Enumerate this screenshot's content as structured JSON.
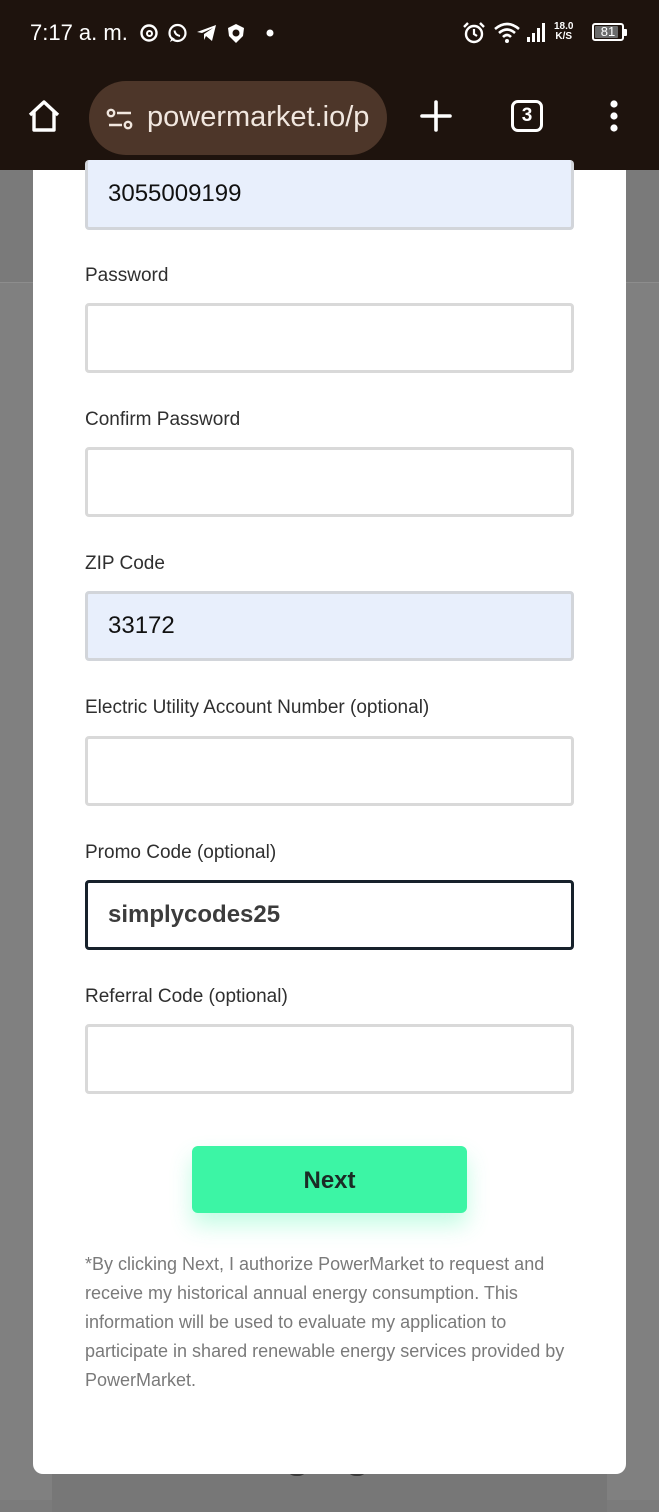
{
  "status_bar": {
    "time": "7:17 a. m.",
    "net_speed_value": "18.0",
    "net_speed_unit": "K/S",
    "battery": "81",
    "icons": [
      "threads-icon",
      "whatsapp-icon",
      "telegram-icon",
      "vpn-shield-icon",
      "notification-dot-icon",
      "alarm-icon",
      "wifi-icon",
      "signal-icon",
      "battery-icon"
    ]
  },
  "browser": {
    "url": "powermarket.io/p",
    "tab_count": "3",
    "icons": [
      "home-icon",
      "site-settings-icon",
      "new-tab-plus-icon",
      "tab-switcher-icon",
      "more-vertical-icon"
    ]
  },
  "form": {
    "phone_value": "3055009199",
    "password_label": "Password",
    "password_value": "",
    "confirm_password_label": "Confirm Password",
    "confirm_password_value": "",
    "zip_label": "ZIP Code",
    "zip_value": "33172",
    "utility_account_label": "Electric Utility Account Number (optional)",
    "utility_account_value": "",
    "promo_label": "Promo Code (optional)",
    "promo_value": "simplycodes25",
    "referral_label": "Referral Code (optional)",
    "referral_value": "",
    "next_label": "Next",
    "disclaimer": "*By clicking Next, I authorize PowerMarket to request and receive my historical annual energy consumption. This information will be used to evaluate my application to participate in shared renewable energy services provided by PowerMarket."
  },
  "colors": {
    "accent": "#3cf5a5",
    "toolbar_bg": "#1e130d",
    "autofill_bg": "#e8effc"
  }
}
